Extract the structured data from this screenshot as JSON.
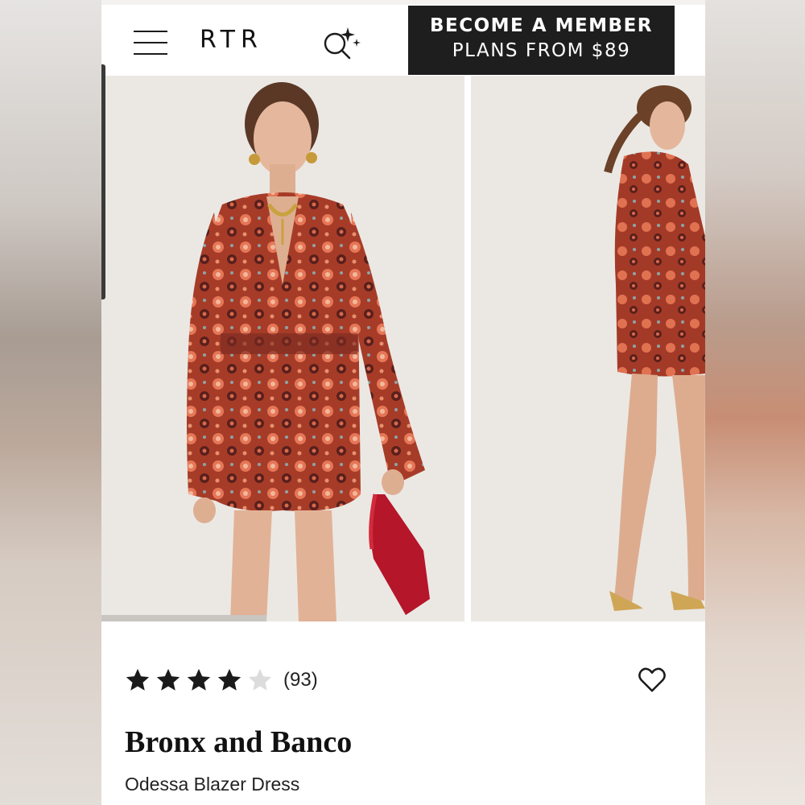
{
  "header": {
    "logo": "RTR",
    "member_cta": {
      "line1": "BECOME A MEMBER",
      "line2": "PLANS FROM $89"
    },
    "icons": {
      "menu": "hamburger-menu-icon",
      "search": "ai-search-icon"
    }
  },
  "gallery": {
    "images": [
      {
        "description": "model-front-view"
      },
      {
        "description": "model-side-view"
      }
    ],
    "scroll_position": 0.0
  },
  "product": {
    "rating": 4,
    "rating_max": 5,
    "review_count": "(93)",
    "brand": "Bronx and Banco",
    "name": "Odessa Blazer Dress",
    "favorite_icon": "heart-outline-icon"
  },
  "colors": {
    "cta_background": "#1e1e1e",
    "star_filled": "#1a1a1a",
    "star_empty": "#dcdcdc",
    "dress_primary": "#b5452c"
  }
}
